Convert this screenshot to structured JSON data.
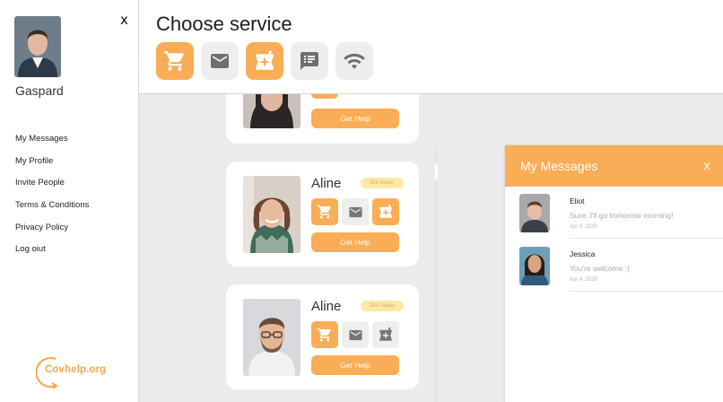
{
  "sidebar": {
    "close_label": "x",
    "user_name": "Gaspard",
    "nav": [
      "My Messages",
      "My Profile",
      "Invite People",
      "Terms & Conditions",
      "Privacy Policy",
      "Log oiut"
    ],
    "logo_text": "Covhelp.org"
  },
  "header": {
    "title": "Choose service",
    "services": [
      {
        "icon": "cart-icon",
        "active": true
      },
      {
        "icon": "mail-icon",
        "active": false
      },
      {
        "icon": "pharmacy-icon",
        "active": true
      },
      {
        "icon": "chat-icon",
        "active": false
      },
      {
        "icon": "wifi-icon",
        "active": false
      }
    ]
  },
  "cards": [
    {
      "name": "",
      "distance": "",
      "help_label": "Get Help"
    },
    {
      "name": "Aline",
      "distance": "5m away",
      "help_label": "Get Help",
      "services": [
        "cart",
        "mail",
        "pharmacy"
      ],
      "active": [
        true,
        false,
        true
      ]
    },
    {
      "name": "Aline",
      "distance": "10m away",
      "help_label": "Get Help",
      "services": [
        "cart",
        "mail",
        "pharmacy"
      ],
      "active": [
        true,
        false,
        false
      ]
    }
  ],
  "messages": {
    "title": "My Messages",
    "close_label": "x",
    "items": [
      {
        "name": "Eliot",
        "text": "Sure, I'll go tomorrow morning!",
        "date": "Apr 5, 2020"
      },
      {
        "name": "Jessica",
        "text": "You're welcome :)",
        "date": "Apr 4, 2020"
      }
    ]
  },
  "colors": {
    "accent": "#f9ad56",
    "badge_bg": "#fde8a8",
    "background": "#ebebeb"
  }
}
